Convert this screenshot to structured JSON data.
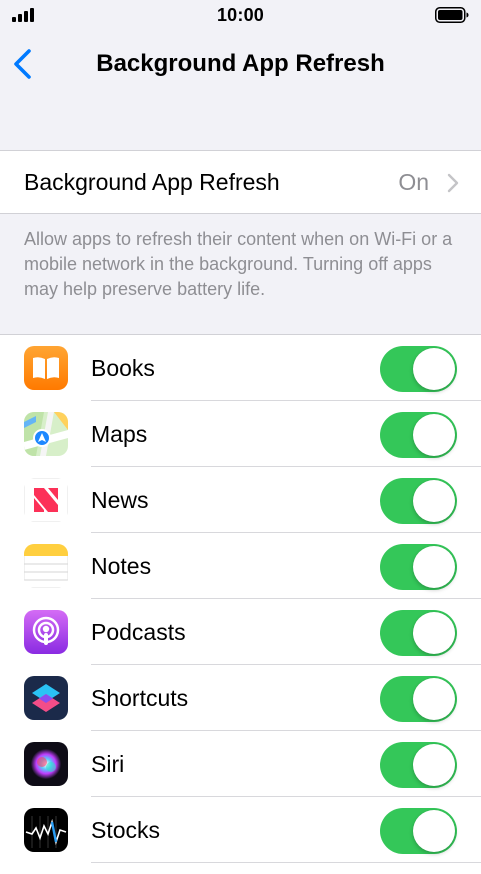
{
  "status_bar": {
    "time": "10:00"
  },
  "nav": {
    "back_icon": "chevron-left-icon",
    "title": "Background App Refresh"
  },
  "main_setting": {
    "label": "Background App Refresh",
    "value": "On"
  },
  "footer_note": "Allow apps to refresh their content when on Wi-Fi or a mobile network in the background. Turning off apps may help preserve battery life.",
  "colors": {
    "toggle_on": "#34c759",
    "accent": "#007aff",
    "secondary_text": "#8e8e93",
    "background": "#f2f2f7"
  },
  "apps": [
    {
      "label": "Books",
      "icon": "books-icon",
      "enabled": true
    },
    {
      "label": "Maps",
      "icon": "maps-icon",
      "enabled": true
    },
    {
      "label": "News",
      "icon": "news-icon",
      "enabled": true
    },
    {
      "label": "Notes",
      "icon": "notes-icon",
      "enabled": true
    },
    {
      "label": "Podcasts",
      "icon": "podcasts-icon",
      "enabled": true
    },
    {
      "label": "Shortcuts",
      "icon": "shortcuts-icon",
      "enabled": true
    },
    {
      "label": "Siri",
      "icon": "siri-icon",
      "enabled": true
    },
    {
      "label": "Stocks",
      "icon": "stocks-icon",
      "enabled": true
    }
  ]
}
